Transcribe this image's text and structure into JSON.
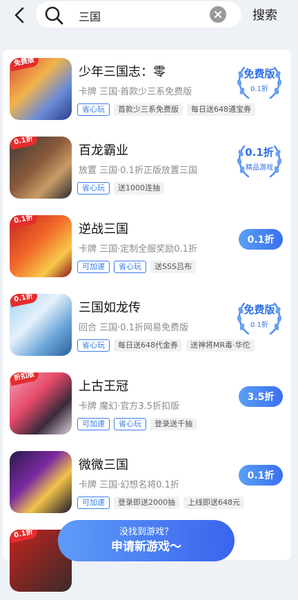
{
  "search": {
    "query": "三国",
    "button_label": "搜索"
  },
  "games": [
    {
      "name": "少年三国志：零",
      "meta": "卡牌 三国·首款少三系免费版",
      "tags": [
        {
          "text": "省心玩",
          "style": "blue"
        },
        {
          "text": "首款少三系免费版",
          "style": "gray"
        },
        {
          "text": "每日送648通宝券",
          "style": "gray"
        }
      ],
      "action": {
        "kind": "badge",
        "line1": "免费版",
        "line2": "0.1折"
      },
      "corner": "免费版"
    },
    {
      "name": "百龙霸业",
      "meta": "放置 三国·0.1折正版放置三国",
      "tags": [
        {
          "text": "省心玩",
          "style": "blue"
        },
        {
          "text": "送1000连抽",
          "style": "gray"
        }
      ],
      "action": {
        "kind": "badge",
        "line1": "0.1折",
        "line2": "精品游戏"
      },
      "corner": "0.1折"
    },
    {
      "name": "逆战三国",
      "meta": "卡牌 三国·定制全服奖励0.1折",
      "tags": [
        {
          "text": "可加速",
          "style": "blue"
        },
        {
          "text": "省心玩",
          "style": "blue"
        },
        {
          "text": "送SSS吕布",
          "style": "gray"
        }
      ],
      "action": {
        "kind": "pill",
        "label": "0.1折"
      },
      "corner": "0.1折"
    },
    {
      "name": "三国如龙传",
      "meta": "回合 三国·0.1折网易免费版",
      "tags": [
        {
          "text": "省心玩",
          "style": "blue"
        },
        {
          "text": "每日送648代金券",
          "style": "gray"
        },
        {
          "text": "送神将MR毒·华佗",
          "style": "gray"
        }
      ],
      "action": {
        "kind": "badge",
        "line1": "免费版",
        "line2": "0.1折"
      },
      "corner": "0.1折"
    },
    {
      "name": "上古王冠",
      "meta": "卡牌 魔幻·官方3.5折扣版",
      "tags": [
        {
          "text": "可加速",
          "style": "blue"
        },
        {
          "text": "省心玩",
          "style": "blue"
        },
        {
          "text": "登录送千抽",
          "style": "gray"
        }
      ],
      "action": {
        "kind": "pill",
        "label": "3.5折"
      },
      "corner": "折扣版"
    },
    {
      "name": "微微三国",
      "meta": "卡牌 三国·幻想名将0.1折",
      "tags": [
        {
          "text": "可加速",
          "style": "blue"
        },
        {
          "text": "登录即送2000抽",
          "style": "gray"
        },
        {
          "text": "上线即送648元",
          "style": "gray"
        }
      ],
      "action": {
        "kind": "pill",
        "label": "0.1折"
      },
      "corner": ""
    }
  ],
  "next_corner": "0.1折",
  "footer": {
    "line1": "没找到游戏？",
    "line2": "申请新游戏～"
  },
  "colors": {
    "accent": "#3a6ff0",
    "tag_blue": "#3a7bec"
  }
}
